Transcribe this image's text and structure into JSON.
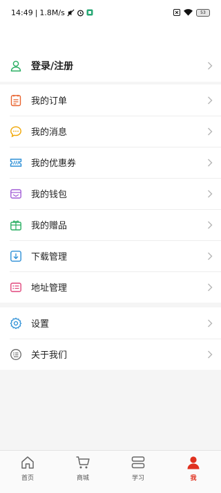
{
  "status_bar": {
    "time": "14:49",
    "separator": "|",
    "speed": "1.8M/s",
    "battery": "53"
  },
  "menu": {
    "login": {
      "label": "登录/注册",
      "icon": "user-icon"
    },
    "group1": [
      {
        "label": "我的订单",
        "icon": "order-icon",
        "color": "#e8612c"
      },
      {
        "label": "我的消息",
        "icon": "message-icon",
        "color": "#f0a500"
      },
      {
        "label": "我的优惠券",
        "icon": "coupon-icon",
        "color": "#2c8fd6"
      },
      {
        "label": "我的钱包",
        "icon": "wallet-icon",
        "color": "#a05bd6"
      },
      {
        "label": "我的赠品",
        "icon": "gift-icon",
        "color": "#27ae60"
      },
      {
        "label": "下载管理",
        "icon": "download-icon",
        "color": "#2c8fd6"
      },
      {
        "label": "地址管理",
        "icon": "address-icon",
        "color": "#e0457b"
      }
    ],
    "group2": [
      {
        "label": "设置",
        "icon": "gear-icon",
        "color": "#2c8fd6"
      },
      {
        "label": "关于我们",
        "icon": "about-icon",
        "color": "#666666"
      }
    ]
  },
  "bottom_nav": [
    {
      "label": "首页",
      "icon": "home-icon",
      "active": false
    },
    {
      "label": "商城",
      "icon": "cart-icon",
      "active": false
    },
    {
      "label": "学习",
      "icon": "study-icon",
      "active": false
    },
    {
      "label": "我",
      "icon": "profile-icon",
      "active": true
    }
  ],
  "colors": {
    "accent": "#e0311f",
    "login_icon": "#27ae60"
  }
}
